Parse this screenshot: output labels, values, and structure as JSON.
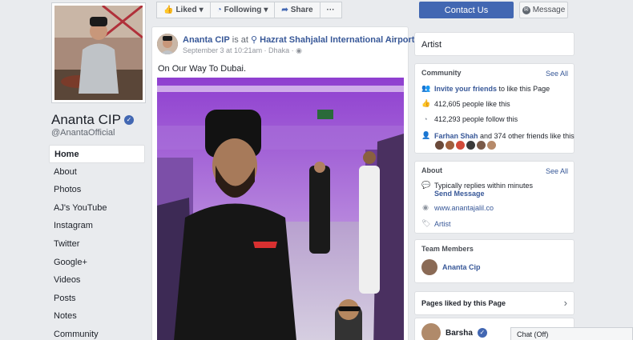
{
  "profile": {
    "name": "Ananta CIP",
    "handle": "@AnantaOfficial"
  },
  "left_nav": [
    {
      "label": "Home",
      "active": true
    },
    {
      "label": "About"
    },
    {
      "label": "Photos"
    },
    {
      "label": "AJ's YouTube"
    },
    {
      "label": "Instagram"
    },
    {
      "label": "Twitter"
    },
    {
      "label": "Google+"
    },
    {
      "label": "Videos"
    },
    {
      "label": "Posts"
    },
    {
      "label": "Notes"
    },
    {
      "label": "Community"
    }
  ],
  "action_bar": {
    "liked": "Liked",
    "following": "Following",
    "share": "Share",
    "more": "···",
    "contact": "Contact Us",
    "message": "Message"
  },
  "post": {
    "author": "Ananta CIP",
    "is_at": "is at",
    "location": "Hazrat Shahjalal International Airport",
    "date": "September 3 at 10:21am · Dhaka ·",
    "text": "On Our Way To Dubai."
  },
  "category_card": {
    "title": "Artist"
  },
  "community": {
    "title": "Community",
    "see_all": "See All",
    "invite": "Invite your friends",
    "invite_suffix": "to like this Page",
    "likes": "412,605 people like this",
    "follows": "412,293 people follow this",
    "friend_name": "Farhan Shah",
    "friends_suffix": "and 374 other friends like this"
  },
  "about": {
    "title": "About",
    "see_all": "See All",
    "replies": "Typically replies within minutes",
    "send_message": "Send Message",
    "website": "www.anantajalil.co",
    "category": "Artist"
  },
  "team": {
    "title": "Team Members",
    "member": "Ananta Cip"
  },
  "pages_liked": {
    "title": "Pages liked by this Page",
    "page": "Barsha"
  },
  "chat": {
    "label": "Chat (Off)"
  },
  "colors": {
    "brand": "#4267b2",
    "link": "#385898",
    "background": "#e9ebee"
  }
}
